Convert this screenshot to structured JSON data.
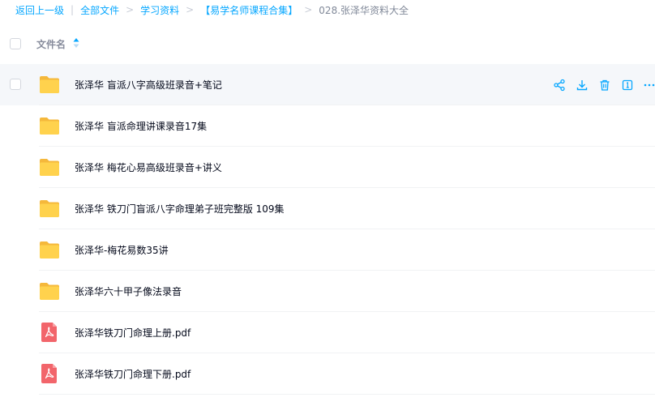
{
  "breadcrumb": {
    "back": "返回上一级",
    "separator": "|",
    "items": [
      "全部文件",
      "学习资料",
      "【易学名师课程合集】"
    ],
    "arrow": ">",
    "current": "028.张泽华资料大全"
  },
  "table": {
    "header_name": "文件名"
  },
  "files": [
    {
      "name": "张泽华 盲派八字高级班录音+笔记",
      "type": "folder"
    },
    {
      "name": "张泽华 盲派命理讲课录音17集",
      "type": "folder"
    },
    {
      "name": "张泽华 梅花心易高级班录音+讲义",
      "type": "folder"
    },
    {
      "name": "张泽华 铁刀门盲派八字命理弟子班完整版 109集",
      "type": "folder"
    },
    {
      "name": "张泽华-梅花易数35讲",
      "type": "folder"
    },
    {
      "name": "张泽华六十甲子像法录音",
      "type": "folder"
    },
    {
      "name": "张泽华铁刀门命理上册.pdf",
      "type": "pdf"
    },
    {
      "name": "张泽华铁刀门命理下册.pdf",
      "type": "pdf"
    }
  ],
  "colors": {
    "accent": "#06a7ff",
    "folder": "#ffd24d",
    "pdf": "#f2656b",
    "hover_bg": "#f5f7fa"
  },
  "row_actions": [
    "share-icon",
    "download-icon",
    "delete-icon",
    "info-icon",
    "more-icon"
  ]
}
